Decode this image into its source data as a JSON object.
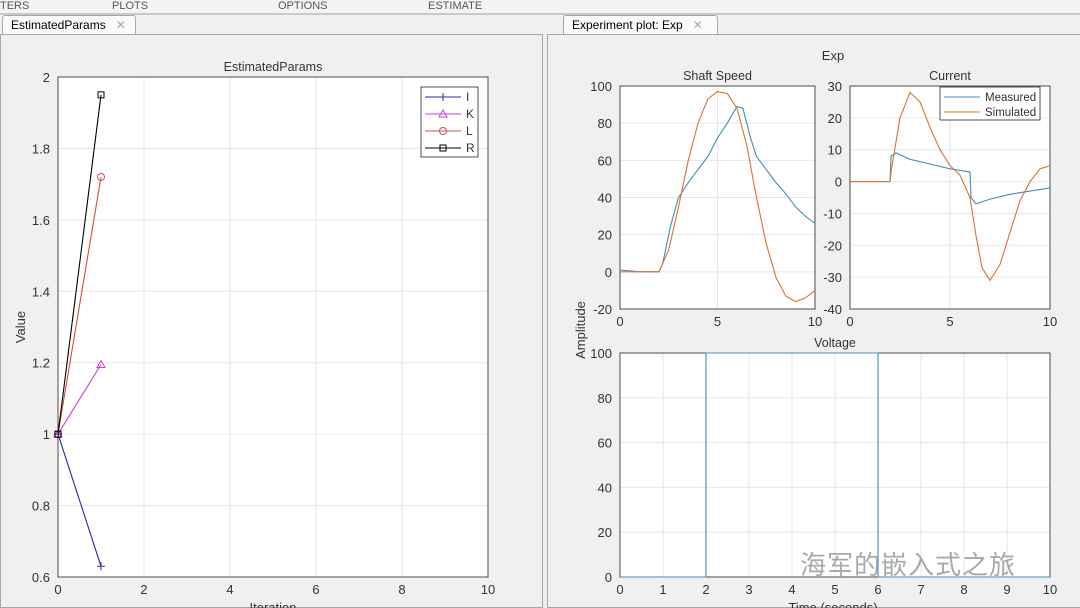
{
  "toolstrip": {
    "tabs": [
      "TERS",
      "PLOTS",
      "OPTIONS",
      "ESTIMATE"
    ]
  },
  "left_tab": {
    "label": "EstimatedParams",
    "close": "✕"
  },
  "right_tab": {
    "label": "Experiment plot: Exp",
    "close": "✕"
  },
  "watermark": "海军的嵌入式之旅",
  "colors": {
    "I": "#2a2aa8",
    "K": "#d040d0",
    "L": "#d94a4a",
    "R": "#000000",
    "measured": "#3d8fb8",
    "simulated": "#e07030"
  },
  "chart_data": [
    {
      "type": "line",
      "title": "EstimatedParams",
      "xlabel": "Iteration",
      "ylabel": "Value",
      "xlim": [
        0,
        10
      ],
      "ylim": [
        0.6,
        2
      ],
      "xticks": [
        0,
        2,
        4,
        6,
        8,
        10
      ],
      "yticks": [
        0.6,
        0.8,
        1,
        1.2,
        1.4,
        1.6,
        1.8,
        2
      ],
      "legend": "top-right",
      "series": [
        {
          "name": "I",
          "x": [
            0,
            1
          ],
          "y": [
            1,
            0.63
          ]
        },
        {
          "name": "K",
          "x": [
            0,
            1
          ],
          "y": [
            1,
            1.195
          ]
        },
        {
          "name": "L",
          "x": [
            0,
            1
          ],
          "y": [
            1,
            1.72
          ]
        },
        {
          "name": "R",
          "x": [
            0,
            1
          ],
          "y": [
            1,
            1.95
          ]
        }
      ]
    },
    {
      "type": "line",
      "figure_title": "Exp",
      "title": "Shaft Speed",
      "xlim": [
        0,
        10
      ],
      "ylim": [
        -20,
        100
      ],
      "xticks": [
        0,
        5,
        10
      ],
      "yticks": [
        -20,
        0,
        20,
        40,
        60,
        80,
        100
      ],
      "series": [
        {
          "name": "Measured",
          "x": [
            0,
            1,
            2,
            2.2,
            2.6,
            3,
            3.5,
            4,
            4.5,
            5,
            5.5,
            6,
            6.3,
            6.7,
            7,
            7.5,
            8,
            8.5,
            9,
            9.5,
            10
          ],
          "y": [
            1,
            0,
            0,
            5,
            25,
            40,
            48,
            55,
            62,
            72,
            80,
            89,
            88,
            72,
            62,
            55,
            48,
            42,
            35,
            30,
            26
          ]
        },
        {
          "name": "Simulated",
          "x": [
            0,
            1,
            2,
            2.5,
            3,
            3.5,
            4,
            4.5,
            5,
            5.5,
            6,
            6.5,
            7,
            7.5,
            8,
            8.5,
            9,
            9.5,
            10
          ],
          "y": [
            0,
            0,
            0,
            12,
            35,
            60,
            80,
            93,
            97,
            96,
            88,
            68,
            40,
            15,
            -3,
            -13,
            -16,
            -14,
            -10
          ]
        }
      ]
    },
    {
      "type": "line",
      "title": "Current",
      "xlim": [
        0,
        10
      ],
      "ylim": [
        -40,
        30
      ],
      "xticks": [
        0,
        5,
        10
      ],
      "yticks": [
        -40,
        -30,
        -20,
        -10,
        0,
        10,
        20,
        30
      ],
      "legend": "top-right",
      "series": [
        {
          "name": "Measured",
          "x": [
            0,
            2,
            2.05,
            2.3,
            3,
            4,
            5,
            6,
            6.05,
            6.3,
            7,
            8,
            9,
            10
          ],
          "y": [
            0,
            0,
            8,
            9,
            7,
            5.5,
            4,
            3,
            -5,
            -7,
            -5.5,
            -4,
            -3,
            -2
          ]
        },
        {
          "name": "Simulated",
          "x": [
            0,
            2,
            2.05,
            2.5,
            3,
            3.5,
            4,
            4.5,
            5,
            5.5,
            6,
            6.3,
            6.6,
            7,
            7.5,
            8,
            8.5,
            9,
            9.5,
            10
          ],
          "y": [
            0,
            0,
            3,
            20,
            28,
            25,
            17,
            10,
            5,
            2,
            -5,
            -17,
            -27,
            -31,
            -26,
            -16,
            -6,
            0,
            4,
            5
          ]
        }
      ]
    },
    {
      "type": "line",
      "title": "Voltage",
      "xlabel": "Time (seconds)",
      "ylabel": "Amplitude",
      "xlim": [
        0,
        10
      ],
      "ylim": [
        0,
        100
      ],
      "xticks": [
        0,
        1,
        2,
        3,
        4,
        5,
        6,
        7,
        8,
        9,
        10
      ],
      "yticks": [
        0,
        20,
        40,
        60,
        80,
        100
      ],
      "series": [
        {
          "name": "Measured",
          "x": [
            0,
            2,
            2,
            6,
            6,
            10
          ],
          "y": [
            0,
            0,
            100,
            100,
            0,
            0
          ]
        }
      ]
    }
  ]
}
